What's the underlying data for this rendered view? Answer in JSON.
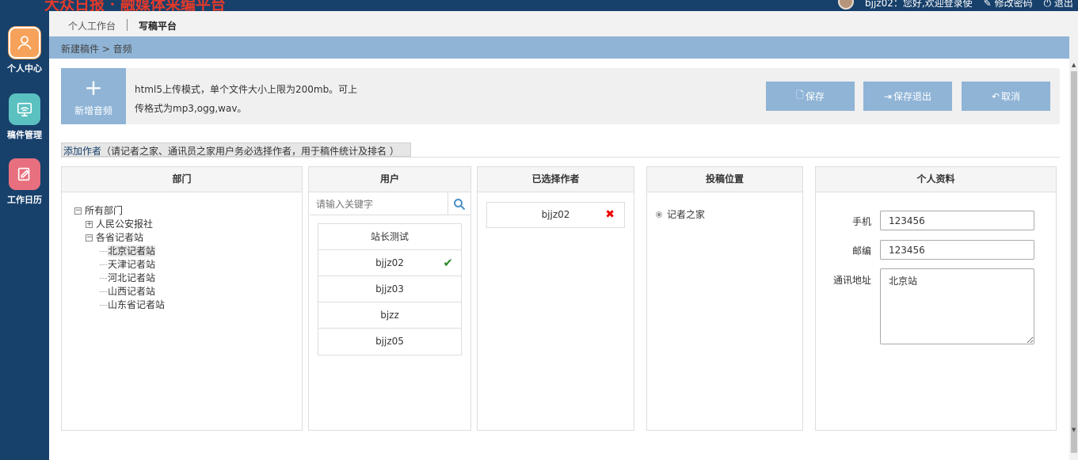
{
  "header": {
    "brand": "大众日报 · 融媒体采编平台",
    "greeting": "bjjz02：您好,欢迎登录使",
    "edit_link": "修改密码",
    "logout_link": "退出"
  },
  "sidebar": {
    "items": [
      {
        "label": "个人中心",
        "icon": "person-icon",
        "color": "#f6a25a"
      },
      {
        "label": "稿件管理",
        "icon": "monitor-icon",
        "color": "#5bc0c0"
      },
      {
        "label": "工作日历",
        "icon": "calendar-edit-icon",
        "color": "#e8707e"
      }
    ]
  },
  "tabs": [
    {
      "label": "个人工作台"
    },
    {
      "label": "写稿平台"
    }
  ],
  "breadcrumb": "新建稿件 > 音频",
  "upload": {
    "add_label": "新增音频",
    "hint_line1": "html5上传模式，单个文件大小上限为200mb。可上",
    "hint_line2": "传格式为mp3,ogg,wav。",
    "save_label": "保存",
    "save_exit_label": "保存退出",
    "cancel_label": "取消"
  },
  "author_bar": {
    "link": "添加作者",
    "note": "（请记者之家、通讯员之家用户务必选择作者，用于稿件统计及排名 ）"
  },
  "panels": {
    "dept": {
      "title": "部门",
      "tree": [
        {
          "label": "所有部门"
        },
        {
          "label": "人民公安报社"
        },
        {
          "label": "各省记者站"
        },
        {
          "label": "北京记者站"
        },
        {
          "label": "天津记者站"
        },
        {
          "label": "河北记者站"
        },
        {
          "label": "山西记者站"
        },
        {
          "label": "山东省记者站"
        }
      ]
    },
    "users": {
      "title": "用户",
      "search_placeholder": "请输入关键字",
      "items": [
        {
          "label": "站长测试"
        },
        {
          "label": "bjjz02"
        },
        {
          "label": "bjjz03"
        },
        {
          "label": "bjzz"
        },
        {
          "label": "bjjz05"
        }
      ],
      "selected_index": 1
    },
    "chosen": {
      "title": "已选择作者",
      "author": "bjjz02"
    },
    "position": {
      "title": "投稿位置",
      "option": "记者之家"
    },
    "profile": {
      "title": "个人资料",
      "phone_label": "手机",
      "phone_value": "123456",
      "zip_label": "邮编",
      "zip_value": "123456",
      "address_label": "通讯地址",
      "address_value": "北京站"
    }
  },
  "colors": {
    "navy": "#17406b",
    "light_blue": "#8fb4d6",
    "check_green": "#2a8a2a",
    "delete_red": "#e00000"
  }
}
